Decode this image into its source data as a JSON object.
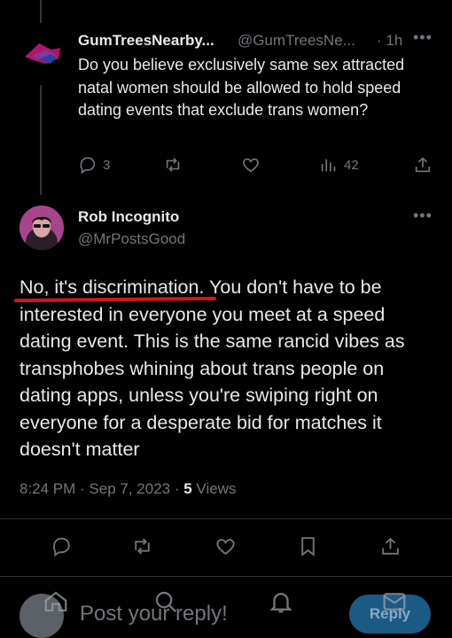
{
  "parent_tweet": {
    "display_name": "GumTreesNearby...",
    "handle": "@GumTreesNe...",
    "time": "· 1h",
    "more": "•••",
    "text": "Do you believe exclusively same sex attracted natal women should be allowed to hold speed dating events that exclude trans women?",
    "replies": "3",
    "views": "42"
  },
  "main_tweet": {
    "display_name": "Rob Incognito",
    "handle": "@MrPostsGood",
    "more": "•••",
    "text": "No, it's discrimination. You don't have to be interested in everyone you meet at a speed dating event. This is the same rancid vibes as transphobes whining about trans people on dating apps, unless you're swiping right on everyone for a desperate bid for matches it doesn't matter",
    "timestamp": "8:24 PM · Sep 7, 2023 · ",
    "views_count": "5",
    "views_label": " Views"
  },
  "reply_box": {
    "placeholder": "Post your reply!",
    "button": "Reply"
  },
  "colors": {
    "background": "#000000",
    "text": "#e7e9ea",
    "muted": "#71767b",
    "underline": "#d4161b",
    "reply_button": "#1c5a86"
  }
}
